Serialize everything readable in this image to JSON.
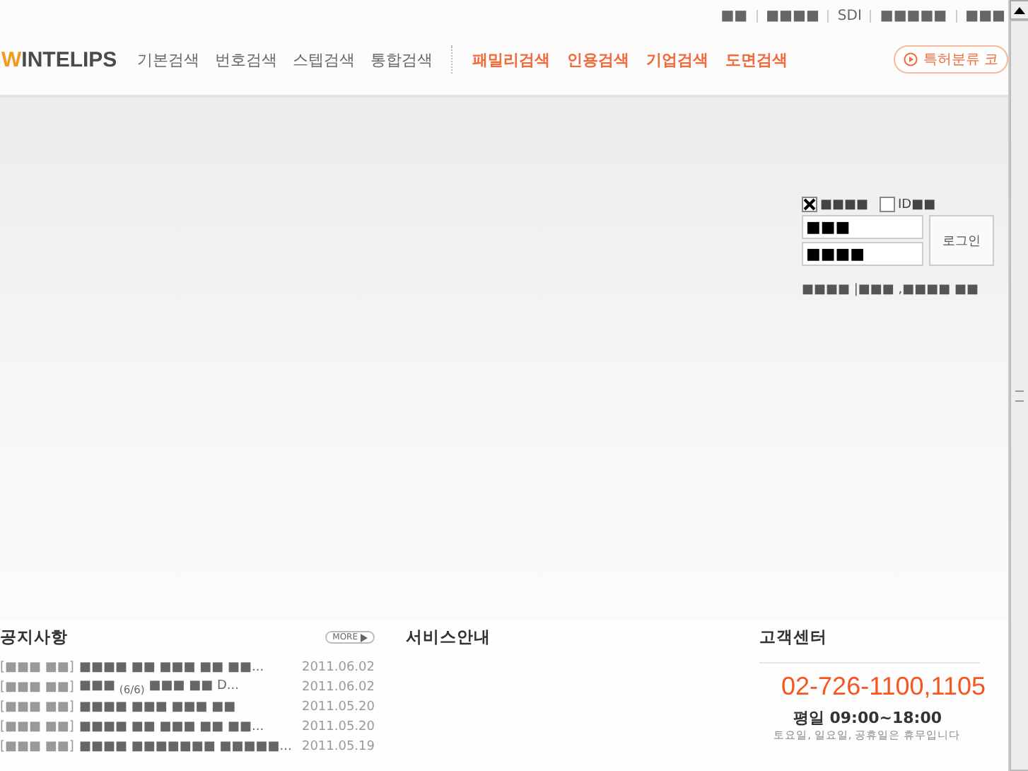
{
  "top_links": [
    "■■",
    "■■■■",
    "SDI",
    "■■■■■",
    "■■■"
  ],
  "logo": {
    "accent": "W",
    "rest": "INTELIPS"
  },
  "nav": [
    {
      "label": "기본검색",
      "kind": "basic"
    },
    {
      "label": "번호검색",
      "kind": "basic"
    },
    {
      "label": "스텝검색",
      "kind": "basic"
    },
    {
      "label": "통합검색",
      "kind": "basic"
    },
    {
      "label": "패밀리검색",
      "kind": "special"
    },
    {
      "label": "인용검색",
      "kind": "special"
    },
    {
      "label": "기업검색",
      "kind": "special"
    },
    {
      "label": "도면검색",
      "kind": "special"
    }
  ],
  "classification_button": "특허분류 코",
  "login": {
    "options": [
      {
        "label": "■■■■",
        "checked": true
      },
      {
        "label": "ID■■",
        "checked": false
      }
    ],
    "id_value": "■■■",
    "password_value": "■■■■",
    "button": "로그인",
    "links": "■■■■ |■■■ ,■■■■ ■■"
  },
  "notice": {
    "title": "공지사항",
    "more": "MORE",
    "rows": [
      {
        "category": "[■■■ ■■]",
        "title": "■■■■ ■■ ■■■ ■■ ■■...",
        "date": "2011.06.02"
      },
      {
        "category": "[■■■ ■■]",
        "title": "■■■ $_{(6/6)}$ ■■■ ■■ D...",
        "date": "2011.06.02"
      },
      {
        "category": "[■■■ ■■]",
        "title": "■■■■ ■■■ ■■■ ■■",
        "date": "2011.05.20"
      },
      {
        "category": "[■■■ ■■]",
        "title": "■■■■ ■■ ■■■ ■■ ■■...",
        "date": "2011.05.20"
      },
      {
        "category": "[■■■ ■■]",
        "title": "■■■■ ■■■■■■■ ■■■■■...",
        "date": "2011.05.19"
      }
    ]
  },
  "service": {
    "title": "서비스안내"
  },
  "customer_center": {
    "title": "고객센터",
    "phone": "02-726-1100,1105",
    "hours": "평일 09:00~18:00",
    "note": "토요일, 일요일, 공휴일은 휴무입니다"
  }
}
